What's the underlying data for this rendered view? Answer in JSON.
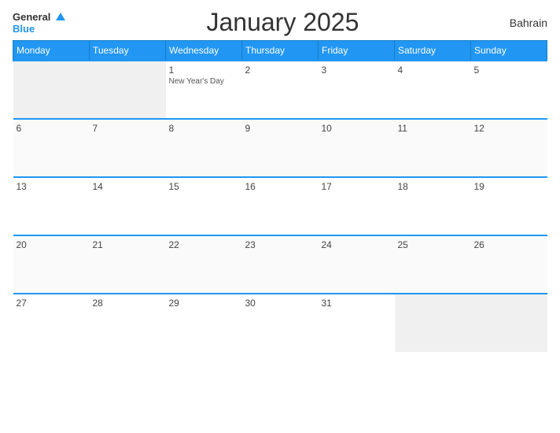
{
  "header": {
    "logo_general": "General",
    "logo_blue": "Blue",
    "title": "January 2025",
    "country": "Bahrain"
  },
  "weekdays": [
    "Monday",
    "Tuesday",
    "Wednesday",
    "Thursday",
    "Friday",
    "Saturday",
    "Sunday"
  ],
  "weeks": [
    [
      {
        "day": "",
        "empty": true
      },
      {
        "day": "",
        "empty": true
      },
      {
        "day": "1",
        "event": "New Year's Day"
      },
      {
        "day": "2"
      },
      {
        "day": "3"
      },
      {
        "day": "4"
      },
      {
        "day": "5"
      }
    ],
    [
      {
        "day": "6"
      },
      {
        "day": "7"
      },
      {
        "day": "8"
      },
      {
        "day": "9"
      },
      {
        "day": "10"
      },
      {
        "day": "11"
      },
      {
        "day": "12"
      }
    ],
    [
      {
        "day": "13"
      },
      {
        "day": "14"
      },
      {
        "day": "15"
      },
      {
        "day": "16"
      },
      {
        "day": "17"
      },
      {
        "day": "18"
      },
      {
        "day": "19"
      }
    ],
    [
      {
        "day": "20"
      },
      {
        "day": "21"
      },
      {
        "day": "22"
      },
      {
        "day": "23"
      },
      {
        "day": "24"
      },
      {
        "day": "25"
      },
      {
        "day": "26"
      }
    ],
    [
      {
        "day": "27"
      },
      {
        "day": "28"
      },
      {
        "day": "29"
      },
      {
        "day": "30"
      },
      {
        "day": "31"
      },
      {
        "day": "",
        "empty": true
      },
      {
        "day": "",
        "empty": true
      }
    ]
  ]
}
